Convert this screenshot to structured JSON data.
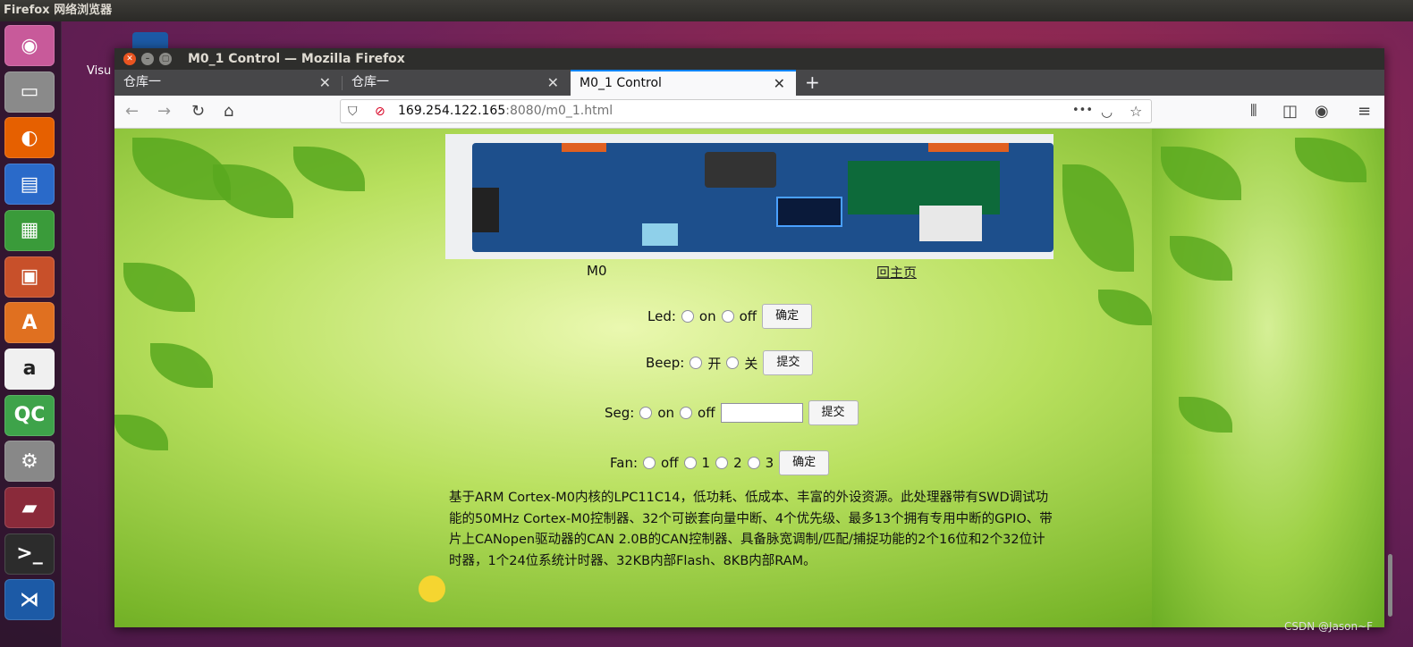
{
  "topbar": {
    "app_name": "Firefox 网络浏览器"
  },
  "desktop": {
    "icon_label": "Visu"
  },
  "launcher": {
    "items": [
      {
        "name": "ubuntu-logo-icon",
        "glyph": "◉",
        "color": "#c85a9a"
      },
      {
        "name": "files-icon",
        "glyph": "▭",
        "color": "#8a8a8a"
      },
      {
        "name": "firefox-icon",
        "glyph": "◐",
        "color": "#e66000"
      },
      {
        "name": "writer-icon",
        "glyph": "▤",
        "color": "#2a6ac9"
      },
      {
        "name": "calc-icon",
        "glyph": "▦",
        "color": "#3a9b3a"
      },
      {
        "name": "impress-icon",
        "glyph": "▣",
        "color": "#c8502a"
      },
      {
        "name": "software-center-icon",
        "glyph": "A",
        "color": "#e07020"
      },
      {
        "name": "amazon-icon",
        "glyph": "a",
        "color": "#f0f0f0"
      },
      {
        "name": "qtcreator-icon",
        "glyph": "QC",
        "color": "#3ea34a"
      },
      {
        "name": "settings-icon",
        "glyph": "⚙",
        "color": "#888"
      },
      {
        "name": "book-icon",
        "glyph": "▰",
        "color": "#8a2a3a"
      },
      {
        "name": "terminal-icon",
        "glyph": ">_",
        "color": "#2c2c2c"
      },
      {
        "name": "vscode-icon",
        "glyph": "⋊",
        "color": "#1c5aa6"
      }
    ]
  },
  "window": {
    "title": "M0_1 Control — Mozilla Firefox"
  },
  "tabs": [
    {
      "label": "仓库一"
    },
    {
      "label": "仓库一"
    },
    {
      "label": "M0_1 Control"
    }
  ],
  "nav": {
    "url_host": "169.254.122.165",
    "url_rest": ":8080/m0_1.html",
    "more": "•••"
  },
  "page": {
    "device_label": "M0",
    "home_link": "回主页",
    "led": {
      "label": "Led:",
      "on": "on",
      "off": "off",
      "button": "确定"
    },
    "beep": {
      "label": "Beep:",
      "on": "开",
      "off": "关",
      "button": "提交"
    },
    "seg": {
      "label": "Seg:",
      "on": "on",
      "off": "off",
      "value": "",
      "button": "提交"
    },
    "fan": {
      "label": "Fan:",
      "opt0": "off",
      "opt1": "1",
      "opt2": "2",
      "opt3": "3",
      "button": "确定"
    },
    "description": "基于ARM Cortex-M0内核的LPC11C14，低功耗、低成本、丰富的外设资源。此处理器带有SWD调试功能的50MHz Cortex-M0控制器、32个可嵌套向量中断、4个优先级、最多13个拥有专用中断的GPIO、带片上CANopen驱动器的CAN 2.0B的CAN控制器、具备脉宽调制/匹配/捕捉功能的2个16位和2个32位计时器，1个24位系统计时器、32KB内部Flash、8KB内部RAM。"
  },
  "watermark": "CSDN @Jason~F"
}
